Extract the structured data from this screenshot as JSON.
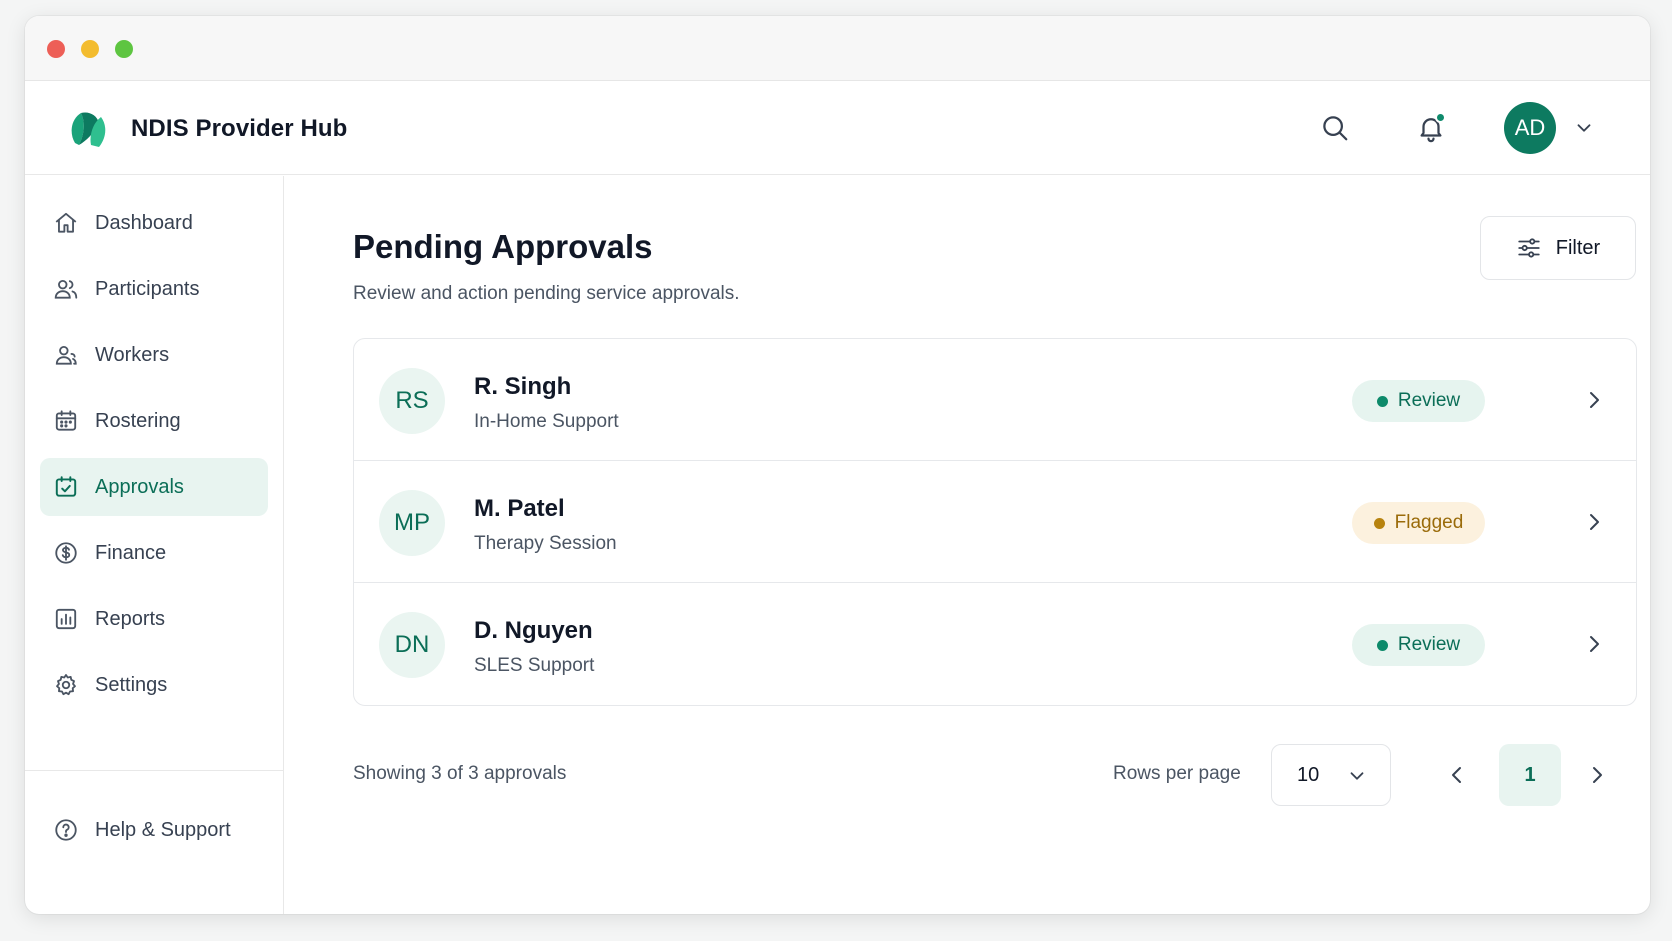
{
  "window": {
    "controls": [
      "close",
      "minimize",
      "zoom"
    ]
  },
  "header": {
    "brand_name": "NDIS Provider Hub",
    "logo_icon": "leaf-logo-icon",
    "avatar_initials": "AD",
    "notification_dot": true,
    "accent_color": "#0d7a60"
  },
  "sidebar": {
    "items": [
      {
        "label": "Dashboard",
        "icon": "home-icon"
      },
      {
        "label": "Participants",
        "icon": "users-icon"
      },
      {
        "label": "Workers",
        "icon": "user-group-icon"
      },
      {
        "label": "Rostering",
        "icon": "calendar-icon"
      },
      {
        "label": "Approvals",
        "icon": "calendar-check-icon",
        "active": true
      },
      {
        "label": "Finance",
        "icon": "dollar-circle-icon"
      },
      {
        "label": "Reports",
        "icon": "bar-chart-icon"
      },
      {
        "label": "Settings",
        "icon": "gear-icon"
      }
    ],
    "help_label": "Help & Support"
  },
  "main": {
    "title": "Pending Approvals",
    "subtitle": "Review and action pending service approvals.",
    "filter_label": "Filter",
    "approvals": [
      {
        "initials": "RS",
        "name": "R. Singh",
        "service": "In-Home Support",
        "status": "Review"
      },
      {
        "initials": "MP",
        "name": "M. Patel",
        "service": "Therapy Session",
        "status": "Flagged"
      },
      {
        "initials": "DN",
        "name": "D. Nguyen",
        "service": "SLES Support",
        "status": "Review"
      }
    ],
    "footer": {
      "showing_text": "Showing 3 of 3 approvals",
      "rows_per_page_label": "Rows per page",
      "rows_per_page_value": "10",
      "current_page": "1"
    }
  },
  "colors": {
    "review_bg": "#e6f4ef",
    "review_fg": "#0b6e57",
    "flagged_bg": "#fcf1de",
    "flagged_fg": "#9a6b0a",
    "active_nav_bg": "#e8f4f0"
  }
}
